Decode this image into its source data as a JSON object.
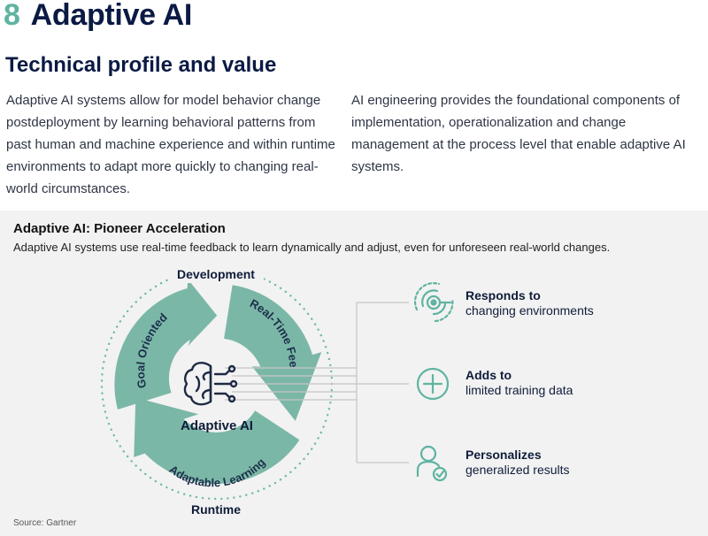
{
  "header": {
    "number": "8",
    "title": "Adaptive AI",
    "subtitle": "Technical profile and value"
  },
  "body_text": {
    "left": "Adaptive AI systems allow for model behavior change postdeployment by learning behavioral patterns from past human and machine experience and within runtime environments to adapt more quickly to changing real-world circumstances.",
    "right": "AI engineering provides the foundational components of implementation, operationalization and change management at the process level that enable adaptive AI systems."
  },
  "panel": {
    "title": "Adaptive AI: Pioneer Acceleration",
    "subtitle": "Adaptive AI systems use real-time feedback to learn dynamically and adjust, even for unforeseen real-world changes.",
    "source": "Source: Gartner"
  },
  "cycle": {
    "center_label": "Adaptive AI",
    "top_label": "Development",
    "bottom_label": "Runtime",
    "arrows": [
      "Real-Time Feedback",
      "Adaptable Learning",
      "Goal Oriented"
    ],
    "center_icon": "brain-circuit-icon"
  },
  "benefits": [
    {
      "line1": "Responds to",
      "line2": "changing environments",
      "icon": "target-signal-icon"
    },
    {
      "line1": "Adds to",
      "line2": "limited training data",
      "icon": "plus-circle-icon"
    },
    {
      "line1": "Personalizes",
      "line2": "generalized results",
      "icon": "person-check-icon"
    }
  ],
  "colors": {
    "accent": "#5fb3a1",
    "arrow_fill": "#7bb7a7",
    "navy": "#0b1a44",
    "panel_bg": "#f2f2f2"
  }
}
